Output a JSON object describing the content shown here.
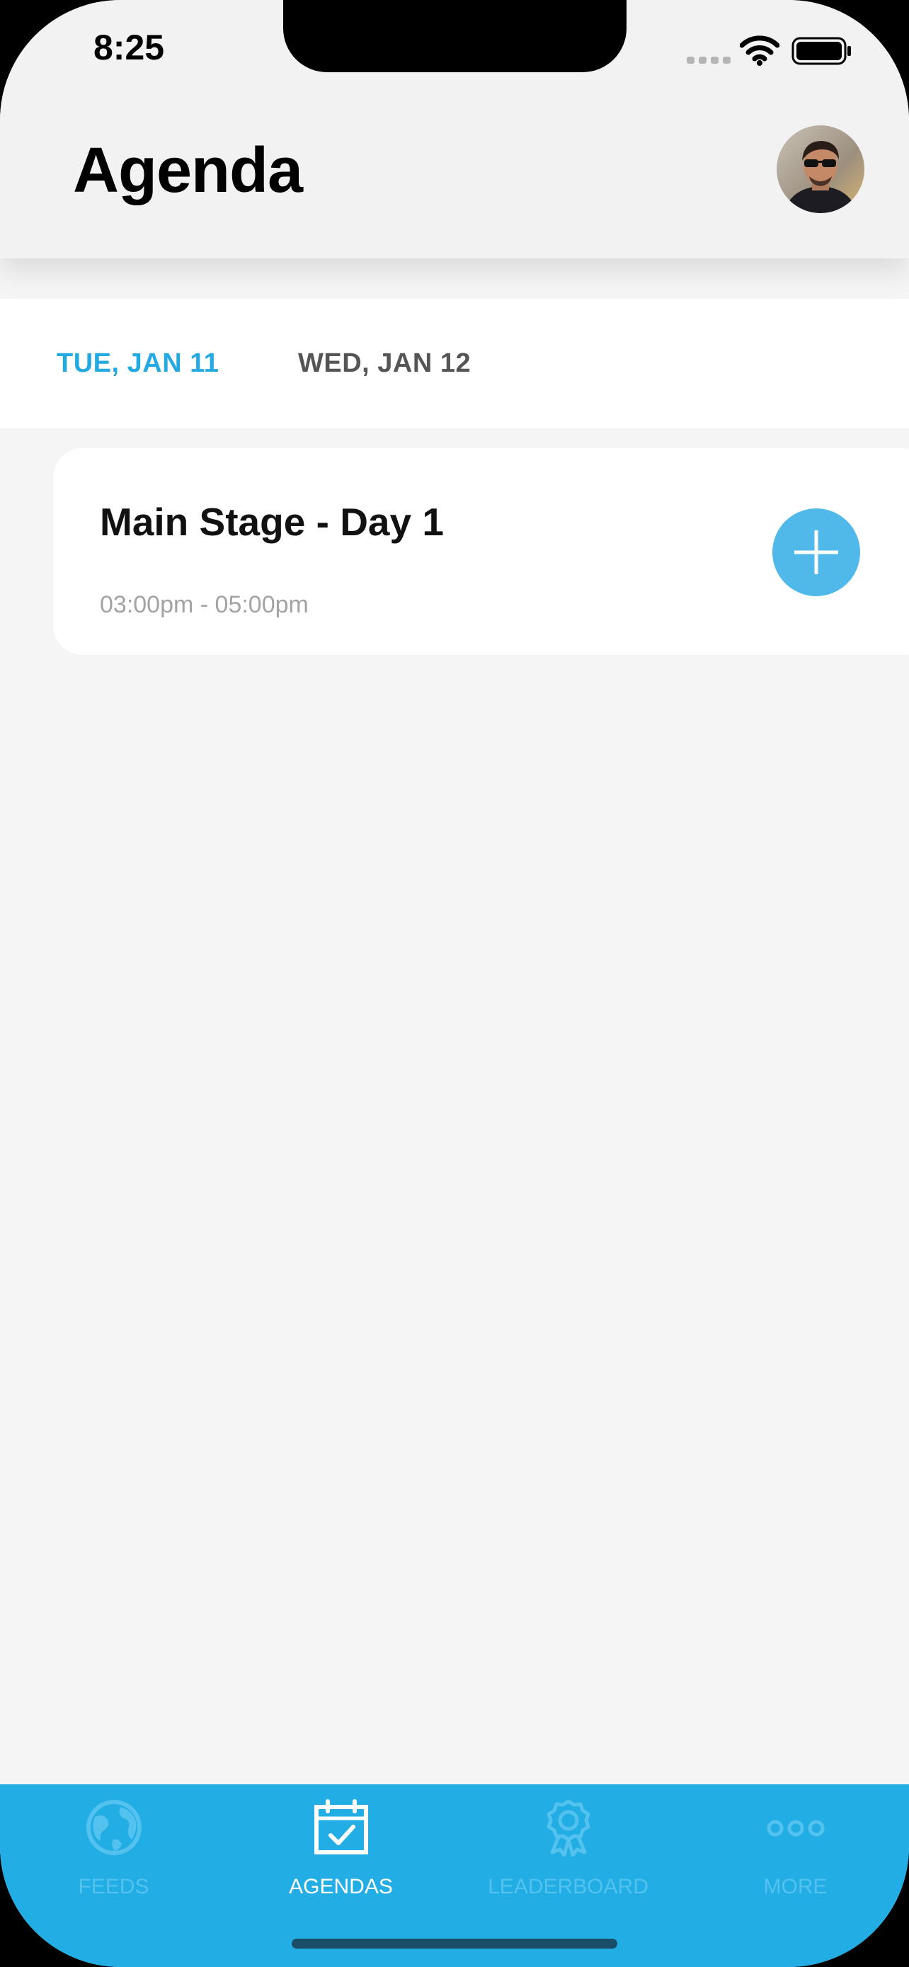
{
  "status_bar": {
    "time": "8:25"
  },
  "header": {
    "title": "Agenda"
  },
  "date_tabs": [
    {
      "label": "TUE, JAN 11",
      "active": true
    },
    {
      "label": "WED, JAN 12",
      "active": false
    }
  ],
  "sessions": [
    {
      "title": "Main Stage - Day 1",
      "time": "03:00pm - 05:00pm"
    }
  ],
  "tab_bar": [
    {
      "label": "FEEDS",
      "icon": "globe-icon",
      "active": false
    },
    {
      "label": "AGENDAS",
      "icon": "calendar-check-icon",
      "active": true
    },
    {
      "label": "LEADERBOARD",
      "icon": "award-ribbon-icon",
      "active": false
    },
    {
      "label": "MORE",
      "icon": "more-dots-icon",
      "active": false
    }
  ],
  "colors": {
    "accent": "#24a9e1",
    "tab_bar_background": "#22ade4",
    "add_button": "#50b9ea"
  }
}
